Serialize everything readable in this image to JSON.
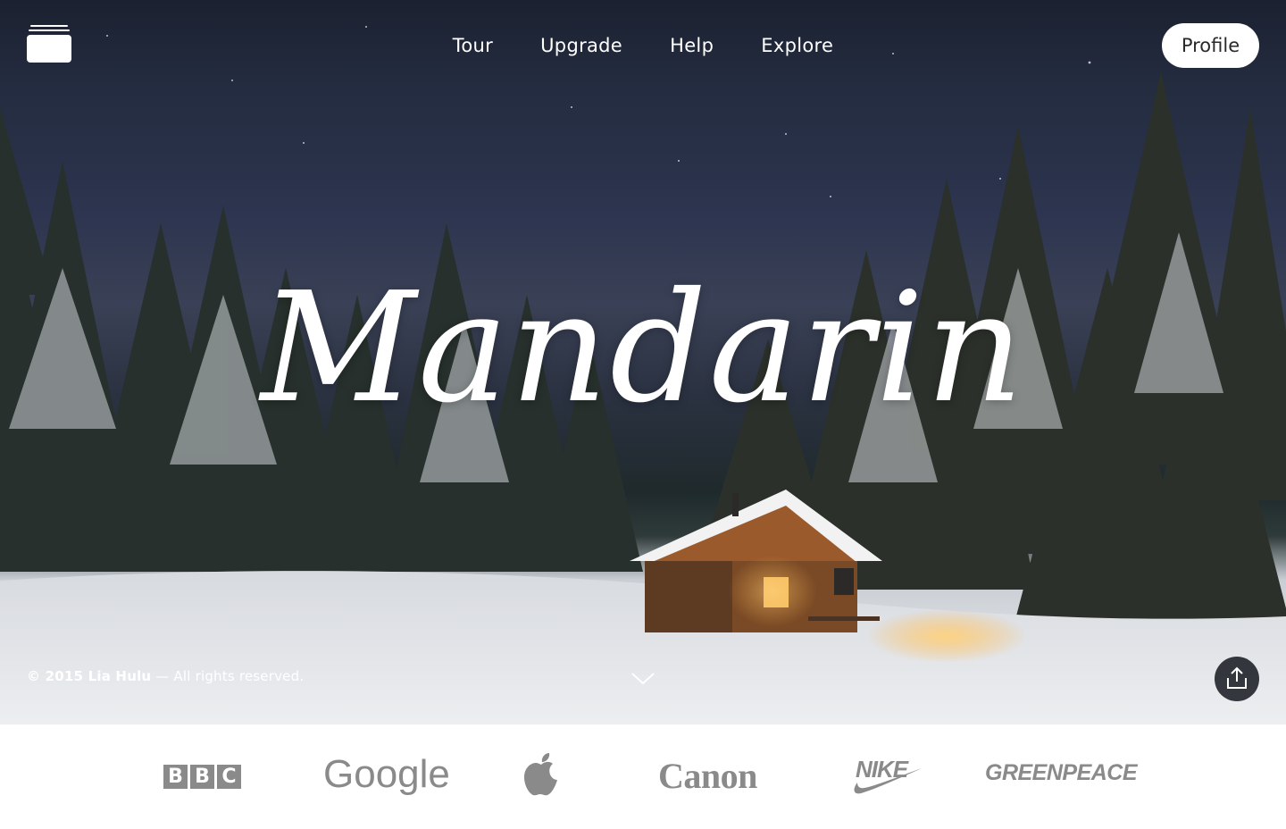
{
  "nav": {
    "menu_icon": "menu-stack-icon",
    "links": [
      "Tour",
      "Upgrade",
      "Help",
      "Explore"
    ],
    "profile_label": "Profile"
  },
  "hero": {
    "title": "Mandarin",
    "copyright_strong": "© 2015 Lia Hulu",
    "copyright_rest": "— All rights reserved.",
    "scroll_icon": "chevron-down-icon",
    "share_icon": "share-upload-icon"
  },
  "brands": {
    "bbc": [
      "B",
      "B",
      "C"
    ],
    "google": "Google",
    "apple_icon": "apple-logo-icon",
    "canon": "Canon",
    "nike": "NIKE",
    "greenpeace": "GREENPEACE"
  },
  "colors": {
    "brand_gray": "#8a8a8a",
    "sky": "#242c40",
    "snow": "#e8eaec"
  }
}
